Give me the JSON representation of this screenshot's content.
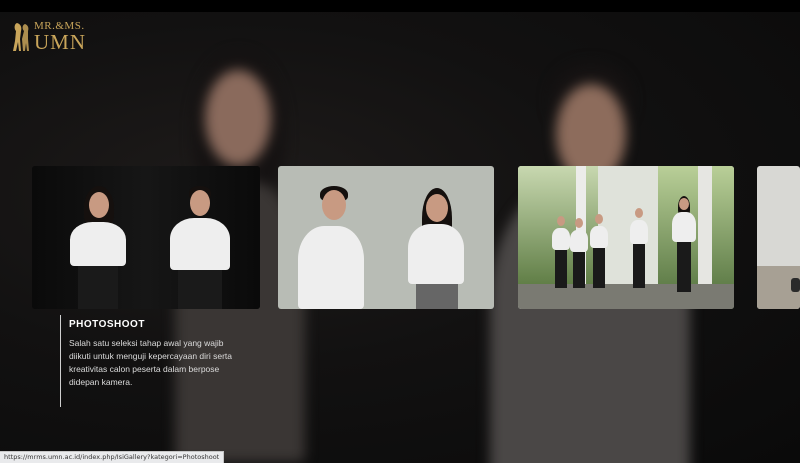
{
  "logo": {
    "top_text": "MR.&MS.",
    "bottom_text": "UMN",
    "color": "#c9a55a"
  },
  "gallery": {
    "cards": [
      {
        "name": "studio-duo-black-background"
      },
      {
        "name": "studio-duo-grey-background"
      },
      {
        "name": "group-pose-outdoor-hall"
      },
      {
        "name": "partial-next-photo"
      }
    ]
  },
  "caption": {
    "title": "PHOTOSHOOT",
    "text": "Salah satu seleksi tahap awal yang wajib diikuti untuk menguji kepercayaan diri serta kreativitas calon peserta dalam berpose didepan kamera."
  },
  "status_bar": {
    "url": "https://mrms.umn.ac.id/index.php/IsiGallery?kategori=Photoshoot"
  }
}
